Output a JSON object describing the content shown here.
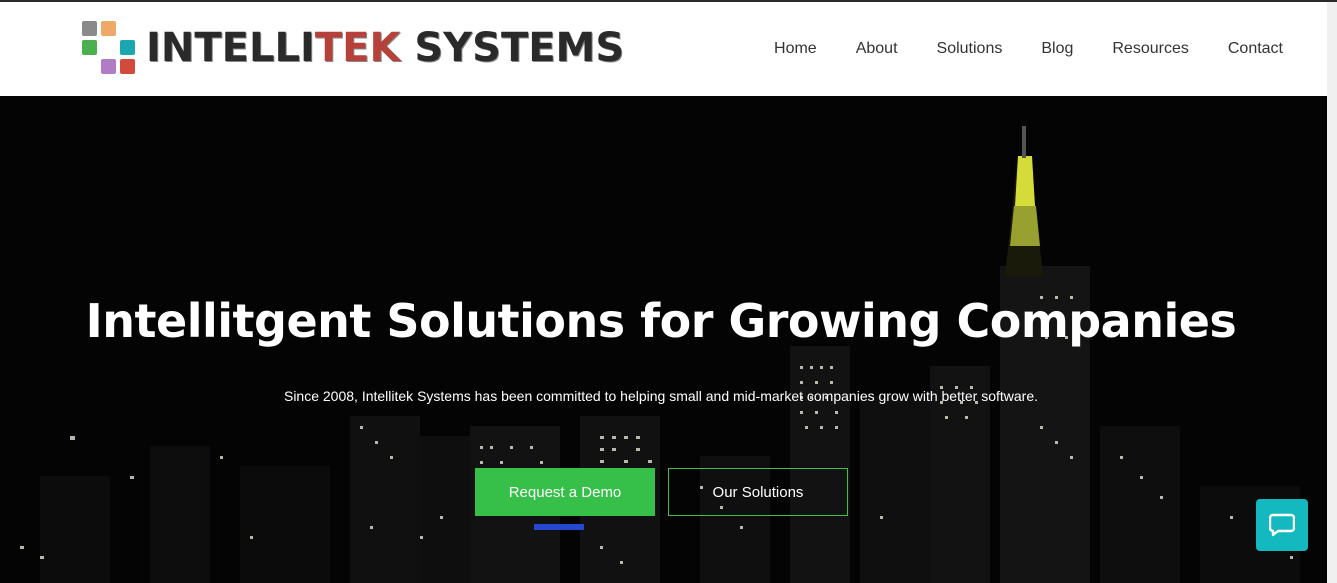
{
  "brand": {
    "name_part1": "INTELLI",
    "name_part2": "TEK",
    "name_part3": " SYSTEMS",
    "colors": {
      "gray": "#8a8a8a",
      "orange": "#f0a868",
      "green": "#4caf50",
      "teal": "#1aa7b0",
      "purple": "#b07cc6",
      "red": "#d24a3c",
      "text": "#2a2a2a",
      "accent_red": "#b5413a"
    }
  },
  "nav": {
    "items": [
      {
        "label": "Home"
      },
      {
        "label": "About"
      },
      {
        "label": "Solutions"
      },
      {
        "label": "Blog"
      },
      {
        "label": "Resources"
      },
      {
        "label": "Contact"
      }
    ]
  },
  "hero": {
    "title": "Intellitgent Solutions for Growing Companies",
    "subtitle": "Since 2008, Intellitek Systems has been committed to helping small and mid-market companies grow with better software.",
    "primary_button": "Request a Demo",
    "secondary_button": "Our Solutions",
    "primary_color": "#36c049",
    "secondary_border_color": "#3dbf4e"
  },
  "chat": {
    "icon": "chat-bubble-icon",
    "color": "#14b8bf"
  }
}
